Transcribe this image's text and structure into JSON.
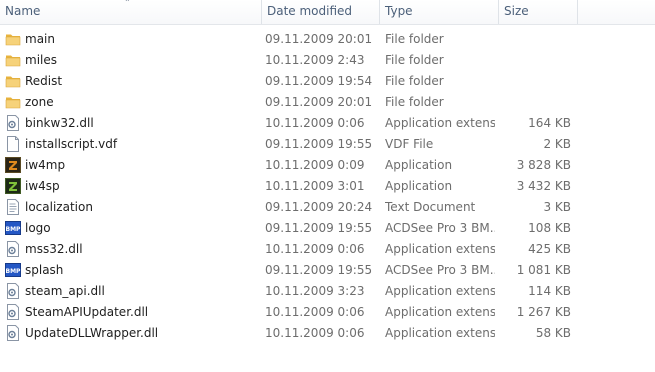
{
  "columns": {
    "name": "Name",
    "date": "Date modified",
    "type": "Type",
    "size": "Size"
  },
  "files": [
    {
      "name": "main",
      "date": "09.11.2009 20:01",
      "type": "File folder",
      "size": "",
      "icon": "folder-icon"
    },
    {
      "name": "miles",
      "date": "10.11.2009 2:43",
      "type": "File folder",
      "size": "",
      "icon": "folder-icon"
    },
    {
      "name": "Redist",
      "date": "09.11.2009 19:54",
      "type": "File folder",
      "size": "",
      "icon": "folder-icon"
    },
    {
      "name": "zone",
      "date": "09.11.2009 20:01",
      "type": "File folder",
      "size": "",
      "icon": "folder-icon"
    },
    {
      "name": "binkw32.dll",
      "date": "10.11.2009 0:06",
      "type": "Application extens...",
      "size": "164 KB",
      "icon": "dll-file-icon"
    },
    {
      "name": "installscript.vdf",
      "date": "09.11.2009 19:55",
      "type": "VDF File",
      "size": "2 KB",
      "icon": "blank-file-icon"
    },
    {
      "name": "iw4mp",
      "date": "10.11.2009 0:09",
      "type": "Application",
      "size": "3 828 KB",
      "icon": "iw4mp-app-icon"
    },
    {
      "name": "iw4sp",
      "date": "10.11.2009 3:01",
      "type": "Application",
      "size": "3 432 KB",
      "icon": "iw4sp-app-icon"
    },
    {
      "name": "localization",
      "date": "09.11.2009 20:24",
      "type": "Text Document",
      "size": "3 KB",
      "icon": "text-file-icon"
    },
    {
      "name": "logo",
      "date": "09.11.2009 19:55",
      "type": "ACDSee Pro 3 BM...",
      "size": "108 KB",
      "icon": "bmp-image-icon"
    },
    {
      "name": "mss32.dll",
      "date": "10.11.2009 0:06",
      "type": "Application extens...",
      "size": "425 KB",
      "icon": "dll-file-icon"
    },
    {
      "name": "splash",
      "date": "09.11.2009 19:55",
      "type": "ACDSee Pro 3 BM...",
      "size": "1 081 KB",
      "icon": "bmp-image-icon"
    },
    {
      "name": "steam_api.dll",
      "date": "10.11.2009 3:23",
      "type": "Application extens...",
      "size": "114 KB",
      "icon": "dll-file-icon"
    },
    {
      "name": "SteamAPIUpdater.dll",
      "date": "10.11.2009 0:06",
      "type": "Application extens...",
      "size": "1 267 KB",
      "icon": "dll-file-icon"
    },
    {
      "name": "UpdateDLLWrapper.dll",
      "date": "10.11.2009 0:06",
      "type": "Application extens...",
      "size": "58 KB",
      "icon": "dll-file-icon"
    }
  ],
  "colors": {
    "header_text": "#4c607a",
    "name_text": "#1e1e1e",
    "detail_text": "#6d6d6d",
    "folder": "#f0c75a"
  }
}
